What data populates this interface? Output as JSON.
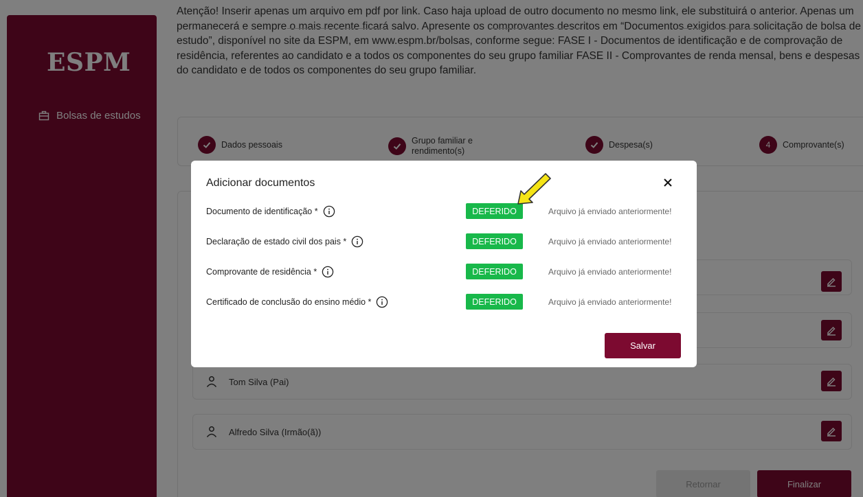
{
  "sidebar": {
    "logo": "ESPM",
    "nav_item": "Bolsas de estudos"
  },
  "notice": "Atenção! Inserir apenas um arquivo em pdf por link. Caso haja upload de outro documento no mesmo link, ele substituirá o anterior. Apenas um permanecerá e sempre o mais recente ficará salvo. Apresente os comprovantes descritos em “Documentos exigidos para solicitação de bolsa de estudo”, disponível no site da ESPM, em www.espm.br/bolsas, conforme segue: FASE I - Documentos de identificação e de comprovação de residência, referentes ao candidato e a todos os componentes do seu grupo familiar FASE II - Comprovantes de renda mensal, bens e despesas do candidato e de todos os componentes do seu grupo familiar.",
  "stepper": {
    "steps": [
      {
        "label": "Dados pessoais",
        "state": "done"
      },
      {
        "label": "Grupo familiar e rendimento(s)",
        "state": "done"
      },
      {
        "label": "Despesa(s)",
        "state": "done"
      },
      {
        "label": "Comprovante(s)",
        "number": "4",
        "state": "current"
      }
    ]
  },
  "members": [
    {
      "name": "Tom Silva (Pai)"
    },
    {
      "name": "Alfredo Silva (Irmão(ã))"
    }
  ],
  "actions": {
    "return_label": "Retornar",
    "finish_label": "Finalizar"
  },
  "modal": {
    "title": "Adicionar documentos",
    "documents": [
      {
        "label": "Documento de identificação *",
        "badge": "DEFERIDO",
        "status": "Arquivo já enviado anteriormente!"
      },
      {
        "label": "Declaração de estado civil dos pais *",
        "badge": "DEFERIDO",
        "status": "Arquivo já enviado anteriormente!"
      },
      {
        "label": "Comprovante de residência *",
        "badge": "DEFERIDO",
        "status": "Arquivo já enviado anteriormente!"
      },
      {
        "label": "Certificado de conclusão do ensino médio *",
        "badge": "DEFERIDO",
        "status": "Arquivo já enviado anteriormente!"
      }
    ],
    "save_label": "Salvar"
  },
  "colors": {
    "brand": "#7c0a30",
    "badge_green": "#18b84a",
    "annotation_arrow": "#f5e416"
  }
}
